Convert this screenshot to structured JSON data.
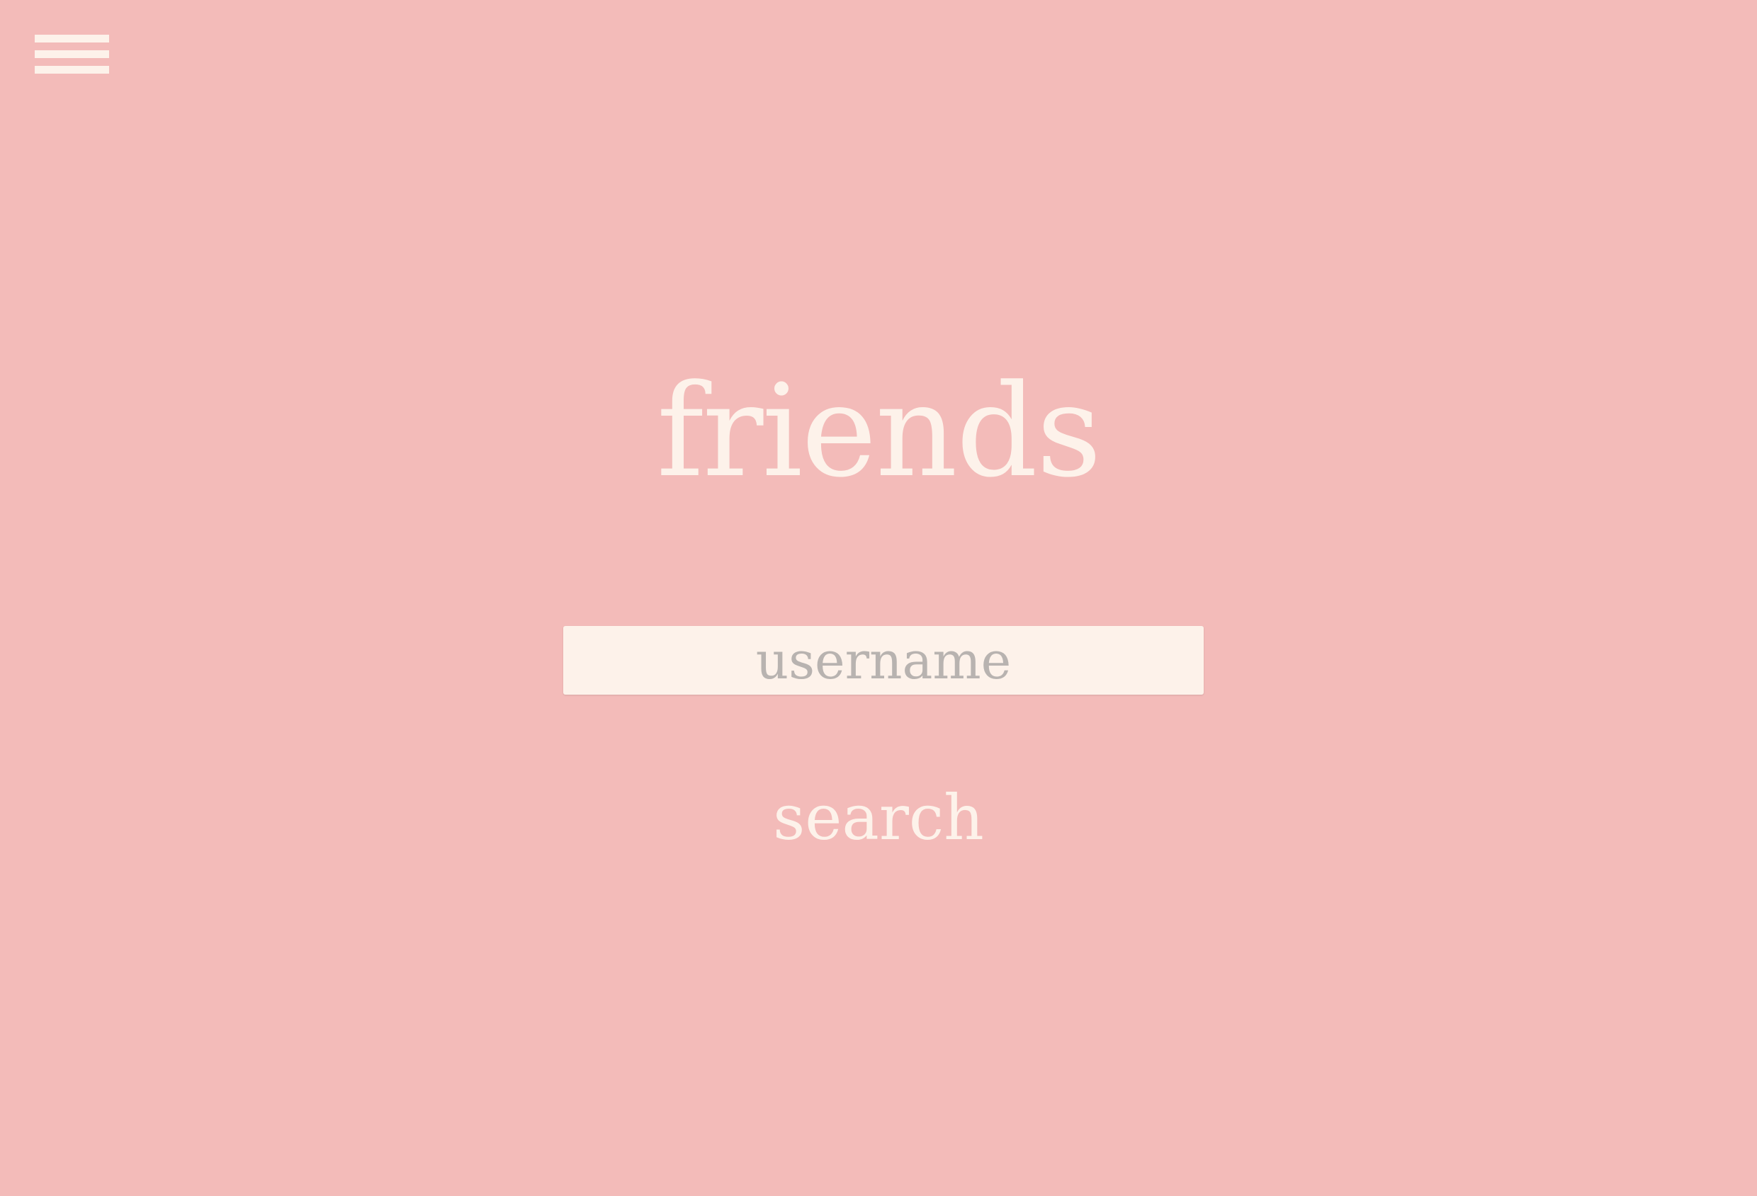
{
  "app": {
    "background_color": "#f3bbb9",
    "foreground_color": "#fdf2ea"
  },
  "header": {
    "menu_icon": "hamburger-menu-icon"
  },
  "main": {
    "title": "friends",
    "username_field": {
      "placeholder": "username",
      "value": ""
    },
    "search_label": "search"
  }
}
